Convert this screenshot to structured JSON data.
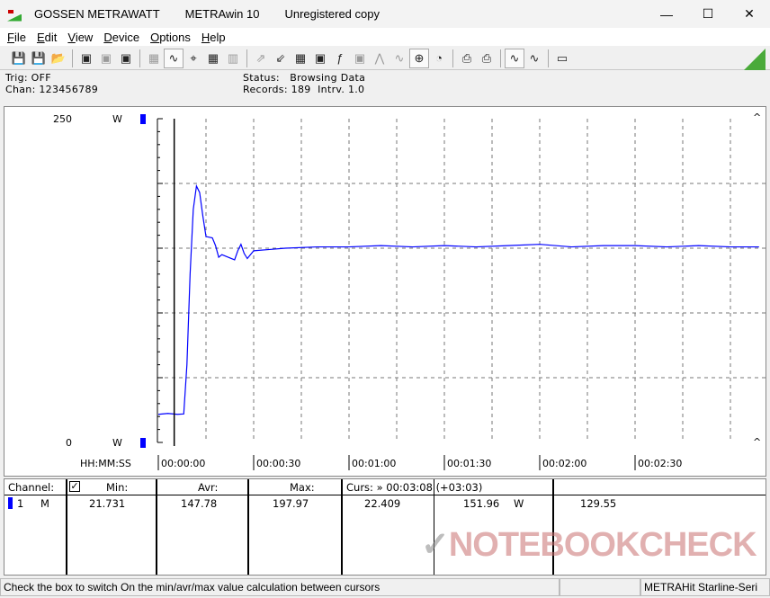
{
  "window": {
    "company": "GOSSEN METRAWATT",
    "app": "METRAwin 10",
    "license": "Unregistered copy",
    "minimize": "—",
    "maximize": "☐",
    "close": "✕"
  },
  "menu": [
    "File",
    "Edit",
    "View",
    "Device",
    "Options",
    "Help"
  ],
  "toolbar": {
    "icons": [
      "save-icon",
      "save-as-icon",
      "open-icon",
      "read-memory-icon",
      "clear-memory-icon",
      "memory-icon",
      "multimeter-icon",
      "oscilloscope-view-icon",
      "crosshair-icon",
      "table-view-icon",
      "histogram-icon",
      "export-icon",
      "import-icon",
      "settings-icon",
      "monitor-icon",
      "function-icon",
      "meter-icon",
      "waveform-icon",
      "waveform2-icon",
      "zoom-check-icon",
      "clock-run-icon",
      "print-icon",
      "print-preview-icon",
      "zoom-wave-icon",
      "zoom-curve-icon",
      "comment-icon"
    ],
    "accent": "#4aaa3a"
  },
  "info": {
    "trig": "Trig: OFF",
    "chan": "Chan:  123456789",
    "status_label": "Status:",
    "status_value": "Browsing Data",
    "records": "Records: 189",
    "interval": "Intrv. 1.0"
  },
  "chart_data": {
    "type": "line",
    "xlabel": "HH:MM:SS",
    "x_ticks": [
      "00:00:00",
      "00:00:30",
      "00:01:00",
      "00:01:30",
      "00:02:00",
      "00:02:30"
    ],
    "y_ticks": [
      "250",
      "0"
    ],
    "y_unit": "W",
    "ylim": [
      0,
      250
    ],
    "xlim_seconds": [
      0,
      189
    ],
    "grid": true,
    "series": [
      {
        "color": "#0000ff",
        "x": [
          0,
          3,
          6,
          8,
          9,
          10,
          11,
          12,
          13,
          14,
          15,
          17,
          18,
          19,
          20,
          22,
          24,
          25,
          26,
          27,
          28,
          30,
          35,
          40,
          50,
          60,
          70,
          80,
          90,
          100,
          110,
          120,
          130,
          140,
          150,
          160,
          170,
          180,
          189
        ],
        "values": [
          21.7,
          22.4,
          21.7,
          22.0,
          60,
          130,
          180,
          197.97,
          193,
          175,
          159,
          158,
          152,
          143,
          145,
          143,
          141,
          148,
          153,
          146,
          142,
          148,
          149,
          150,
          151,
          151,
          152,
          151,
          152,
          151,
          152,
          153,
          151,
          152,
          152,
          151,
          152,
          151,
          151
        ]
      }
    ],
    "cursor_seconds": 5
  },
  "table": {
    "channel_label": "Channel:",
    "checked": true,
    "min_label": "Min:",
    "avr_label": "Avr:",
    "max_label": "Max:",
    "curs_label": "Curs: » 00:03:08 (+03:03)",
    "row": {
      "num": "1",
      "mode": "M",
      "min": "21.731",
      "avr": "147.78",
      "max": "197.97",
      "c1": "22.409",
      "c2": "151.96",
      "unit": "W",
      "c3": "129.55",
      "color": "#0000ff"
    }
  },
  "watermark": "NOTEBOOKCHECK",
  "statusbar": {
    "hint": "Check the box to switch On the min/avr/max value calculation between cursors",
    "device": "METRAHit Starline-Seri"
  }
}
